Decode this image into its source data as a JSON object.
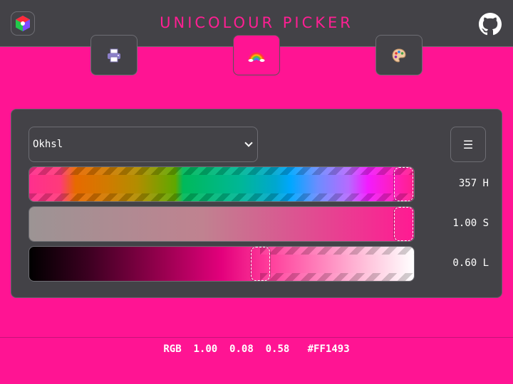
{
  "header": {
    "title": "UNICOLOUR PICKER",
    "logo_icon": "rgb-cube-logo-icon",
    "github_icon": "github-icon"
  },
  "tabs": [
    {
      "icon": "printer-icon",
      "active": false
    },
    {
      "icon": "rainbow-icon",
      "active": true
    },
    {
      "icon": "palette-icon",
      "active": false
    }
  ],
  "picker": {
    "colour_space": "Okhsl",
    "menu_label": "☰",
    "channels": [
      {
        "name": "H",
        "value_text": "357 H",
        "value": 357,
        "max": 360
      },
      {
        "name": "S",
        "value_text": "1.00 S",
        "value": 1.0,
        "max": 1.0
      },
      {
        "name": "L",
        "value_text": "0.60 L",
        "value": 0.6,
        "max": 1.0
      }
    ]
  },
  "footer": {
    "text": "RGB  1.00  0.08  0.58   #FF1493"
  },
  "colors": {
    "accent": "#ff1493",
    "panel": "#434247"
  }
}
